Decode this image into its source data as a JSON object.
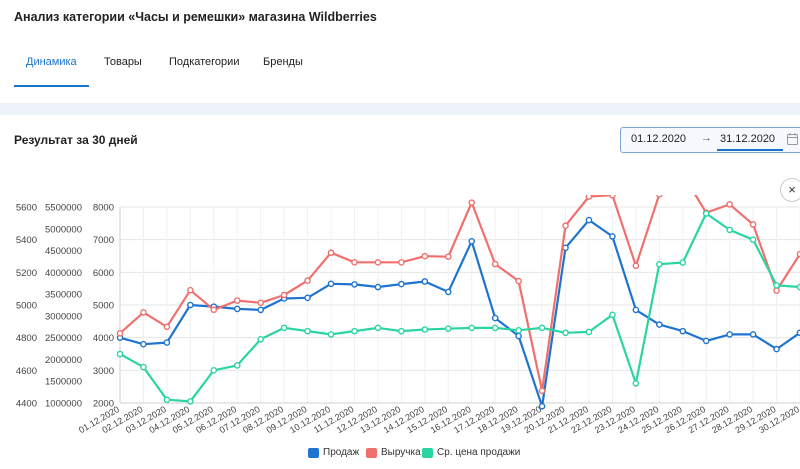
{
  "page": {
    "title": "Анализ категории «Часы и ремешки» магазина Wildberries"
  },
  "tabs": [
    {
      "label": "Динамика",
      "active": true
    },
    {
      "label": "Товары",
      "active": false
    },
    {
      "label": "Подкатегории",
      "active": false
    },
    {
      "label": "Бренды",
      "active": false
    }
  ],
  "section": {
    "title": "Результат за 30 дней"
  },
  "date_range": {
    "from": "01.12.2020",
    "separator": "→",
    "to": "31.12.2020"
  },
  "close_label": "×",
  "colors": {
    "sales": "#1f74cf",
    "revenue": "#f0706e",
    "price": "#2bd5a2",
    "accent": "#1a73c9",
    "grid": "#e6e6e6"
  },
  "chart_data": {
    "type": "line",
    "x": [
      "01.12.2020",
      "02.12.2020",
      "03.12.2020",
      "04.12.2020",
      "05.12.2020",
      "06.12.2020",
      "07.12.2020",
      "08.12.2020",
      "09.12.2020",
      "10.12.2020",
      "11.12.2020",
      "12.12.2020",
      "13.12.2020",
      "14.12.2020",
      "15.12.2020",
      "16.12.2020",
      "17.12.2020",
      "18.12.2020",
      "19.12.2020",
      "20.12.2020",
      "21.12.2020",
      "22.12.2020",
      "23.12.2020",
      "24.12.2020",
      "25.12.2020",
      "26.12.2020",
      "27.12.2020",
      "28.12.2020",
      "29.12.2020",
      "30.12.2020"
    ],
    "axes": [
      {
        "id": "price",
        "ticks": [
          "4400",
          "4600",
          "4800",
          "5000",
          "5200",
          "5400",
          "5600"
        ],
        "min": 4400,
        "max": 5600
      },
      {
        "id": "revenue",
        "ticks": [
          "1000000",
          "1500000",
          "2000000",
          "2500000",
          "3000000",
          "3500000",
          "4000000",
          "4500000",
          "5000000",
          "5500000"
        ],
        "min": 1000000,
        "max": 5500000
      },
      {
        "id": "sales",
        "ticks": [
          "2000",
          "3000",
          "4000",
          "5000",
          "6000",
          "7000",
          "8000"
        ],
        "min": 2000,
        "max": 8000
      }
    ],
    "series": [
      {
        "name": "Продаж",
        "axis": "sales",
        "color": "#1f74cf",
        "values": [
          4000,
          3800,
          3850,
          5000,
          4950,
          4880,
          4850,
          5200,
          5220,
          5650,
          5630,
          5550,
          5640,
          5720,
          5400,
          6950,
          4600,
          4050,
          1900,
          6750,
          7600,
          7100,
          4850,
          4400,
          4200,
          3900,
          4100,
          4100,
          3650,
          4150
        ]
      },
      {
        "name": "Выручка",
        "axis": "revenue",
        "color": "#f0706e",
        "values": [
          2600000,
          3080000,
          2750000,
          3590000,
          3140000,
          3350000,
          3300000,
          3480000,
          3810000,
          4450000,
          4230000,
          4230000,
          4230000,
          4370000,
          4360000,
          5600000,
          4190000,
          3800000,
          1280000,
          5070000,
          5740000,
          5770000,
          4150000,
          5790000,
          6250000,
          5370000,
          5560000,
          5100000,
          3580000,
          4420000
        ]
      },
      {
        "name": "Ср. цена продажи",
        "axis": "price",
        "color": "#2bd5a2",
        "values": [
          4700,
          4620,
          4420,
          4410,
          4600,
          4630,
          4790,
          4860,
          4840,
          4820,
          4840,
          4860,
          4840,
          4850,
          4855,
          4860,
          4860,
          4845,
          4860,
          4830,
          4835,
          4940,
          4520,
          5250,
          5260,
          5560,
          5460,
          5400,
          5120,
          5110
        ]
      }
    ],
    "legend_position": "bottom-center",
    "grid": true
  }
}
